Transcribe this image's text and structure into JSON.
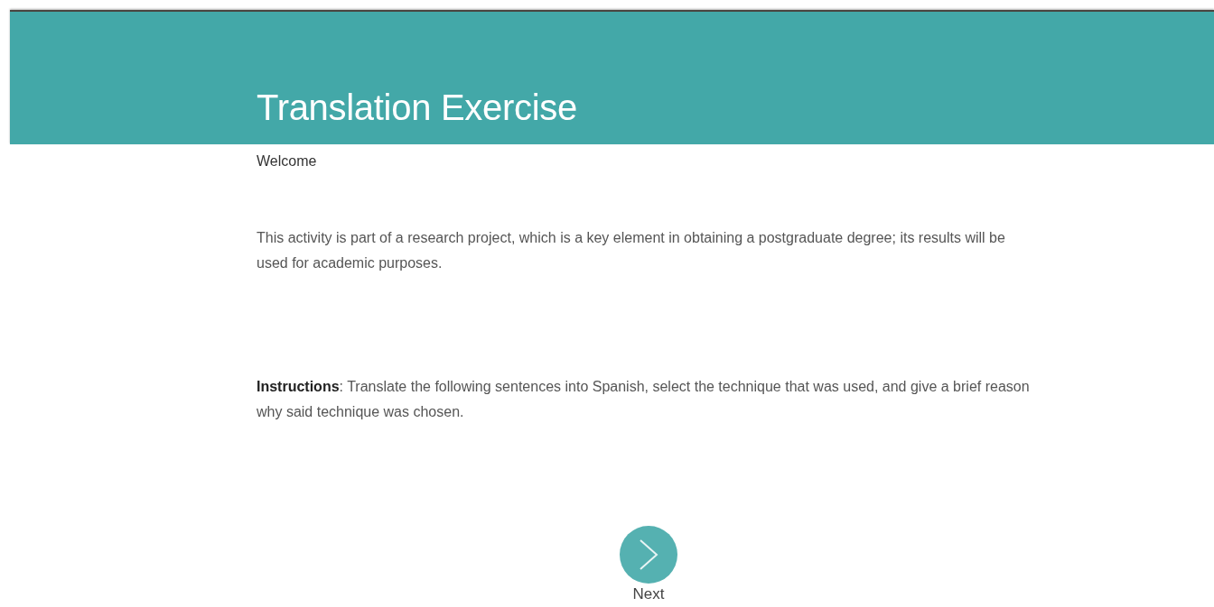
{
  "header": {
    "title": "Translation Exercise"
  },
  "welcome": "Welcome",
  "intro": "This activity is part of a research project, which is a key element in obtaining a postgraduate degree; its results will be used for academic purposes.",
  "instructions": "**Instructions**: Translate the following sentences into Spanish, select the technique that was used, and give a brief reason why said technique was chosen.",
  "next_button": {
    "label": "Next"
  }
}
